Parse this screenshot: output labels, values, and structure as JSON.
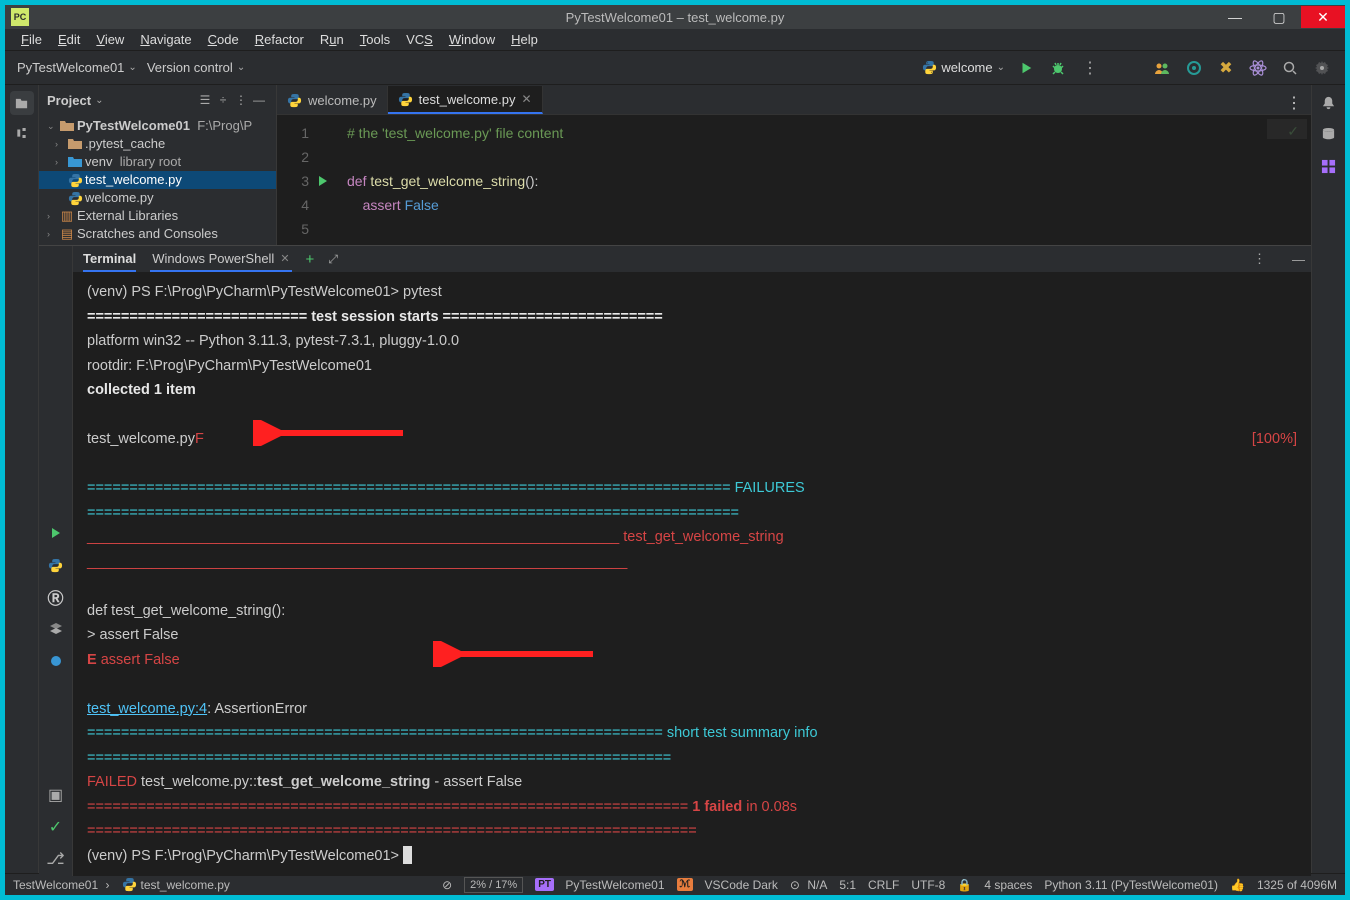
{
  "title": "PyTestWelcome01 – test_welcome.py",
  "menu": [
    "File",
    "Edit",
    "View",
    "Navigate",
    "Code",
    "Refactor",
    "Run",
    "Tools",
    "VCS",
    "Window",
    "Help"
  ],
  "toolbar": {
    "project": "PyTestWelcome01",
    "vcs": "Version control",
    "run_config": "welcome"
  },
  "project_panel": {
    "title": "Project",
    "root": "PyTestWelcome01",
    "root_path": "F:\\Prog\\P",
    "items": [
      {
        "label": ".pytest_cache"
      },
      {
        "label": "venv",
        "suffix": "library root"
      },
      {
        "label": "test_welcome.py",
        "selected": true
      },
      {
        "label": "welcome.py"
      }
    ],
    "external": "External Libraries",
    "scratches": "Scratches and Consoles"
  },
  "tabs": [
    {
      "label": "welcome.py",
      "active": false
    },
    {
      "label": "test_welcome.py",
      "active": true
    }
  ],
  "code": {
    "lines": [
      {
        "n": "1",
        "content": "# the 'test_welcome.py' file content",
        "type": "cmt"
      },
      {
        "n": "2",
        "content": "",
        "type": ""
      },
      {
        "n": "3",
        "content": "def test_get_welcome_string():",
        "type": "def"
      },
      {
        "n": "4",
        "content": "    assert False",
        "type": "assert"
      },
      {
        "n": "5",
        "content": "",
        "type": ""
      }
    ]
  },
  "terminal": {
    "tab1": "Terminal",
    "tab2": "Windows PowerShell",
    "prompt1": "(venv) PS F:\\Prog\\PyCharm\\PyTestWelcome01>",
    "cmd1": "pytest",
    "session_header": "========================== test session starts ==========================",
    "platform": "platform win32 -- Python 3.11.3, pytest-7.3.1, pluggy-1.0.0",
    "rootdir": "rootdir: F:\\Prog\\PyCharm\\PyTestWelcome01",
    "collected": "collected 1 item",
    "test_file": "test_welcome.py ",
    "test_fail": "F",
    "percent": "[100%]",
    "failures_hdr": "============================================================================ FAILURES =============================================================================",
    "failed_test_hdr": "__________________________________________________________________ test_get_welcome_string ___________________________________________________________________",
    "src1": "    def test_get_welcome_string():",
    "src2": ">       assert False",
    "src3_e": "E",
    "src3_txt": "       assert False",
    "err_file": "test_welcome.py:4",
    "err_rest": ": AssertionError",
    "summary_hdr": "==================================================================== short test summary info =====================================================================",
    "failed_word": "FAILED",
    "failed_line": " test_welcome.py::",
    "failed_test": "test_get_welcome_string",
    "failed_reason": " - assert False",
    "footer_pre": "======================================================================= ",
    "footer_red": "1 failed",
    "footer_mid": " in 0.08s",
    "footer_post": " ========================================================================",
    "prompt2": "(venv) PS F:\\Prog\\PyCharm\\PyTestWelcome01>"
  },
  "status": {
    "breadcrumb_project": "TestWelcome01",
    "breadcrumb_file": "test_welcome.py",
    "progress": "2% /  17%",
    "badge_pt": "PT",
    "pt_label": "PyTestWelcome01",
    "badge_m": "ℳ",
    "theme": "VSCode Dark",
    "na": "N/A",
    "pos": "5:1",
    "eol": "CRLF",
    "enc": "UTF-8",
    "indent": "4 spaces",
    "interp": "Python 3.11 (PyTestWelcome01)",
    "mem": "1325 of 4096M"
  }
}
